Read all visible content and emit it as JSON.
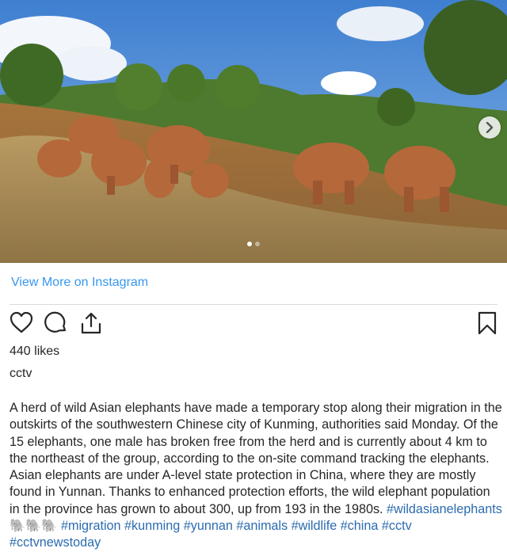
{
  "post": {
    "view_more_label": "View More on Instagram",
    "likes": "440 likes",
    "username": "cctv",
    "caption_before": "A herd of wild Asian elephants have made a temporary stop along their migration in the outskirts of the southwestern Chinese city of Kunming, authorities said Monday. Of the 15 elephants, one male has broken free from the herd and is currently about 4 km to the northeast of the group, according to the on-site command tracking the elephants. Asian elephants are under A-level state protection in China, where they are mostly found in Yunnan. Thanks to enhanced protection efforts, the wild elephant population in the province has grown to about 300, up from 193 in the 1980s. ",
    "hashtags_line1": "#wildasianelephants",
    "emojis": "🐘🐘🐘",
    "hashtags_line2": "#migration #kunming",
    "hashtags_line3": "#yunnan #animals #wildlife #china #cctv #cctvnewstoday"
  },
  "carousel": {
    "slides": 2,
    "active": 1
  },
  "icons": {
    "next": "chevron-right-icon",
    "like": "heart-icon",
    "comment": "comment-icon",
    "share": "share-icon",
    "save": "bookmark-icon"
  },
  "colors": {
    "link": "#3897f0",
    "hashtag": "#2b6cb0",
    "text": "#262626"
  }
}
